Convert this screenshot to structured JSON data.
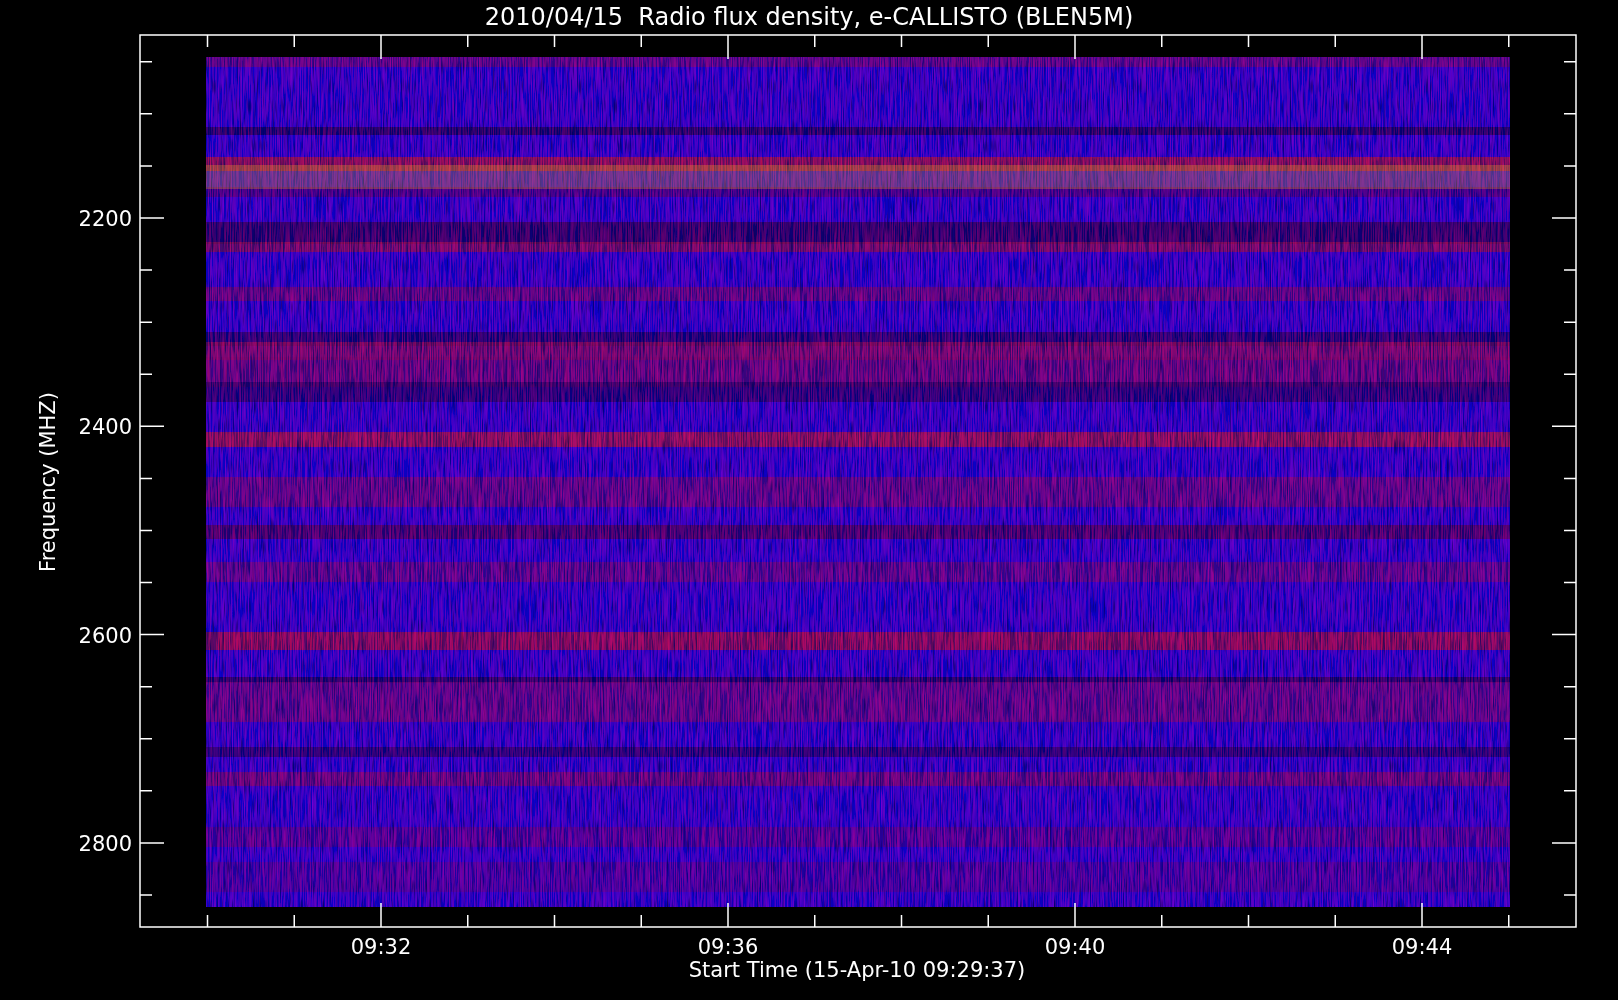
{
  "title": "2010/04/15  Radio flux density, e-CALLISTO (BLEN5M)",
  "y_axis": {
    "label": "Frequency (MHZ)",
    "ticks": [
      "2200",
      "2400",
      "2600",
      "2800"
    ]
  },
  "x_axis": {
    "label": "Start Time (15-Apr-10 09:29:37)",
    "ticks": [
      "09:32",
      "09:36",
      "09:40",
      "09:44"
    ]
  }
}
